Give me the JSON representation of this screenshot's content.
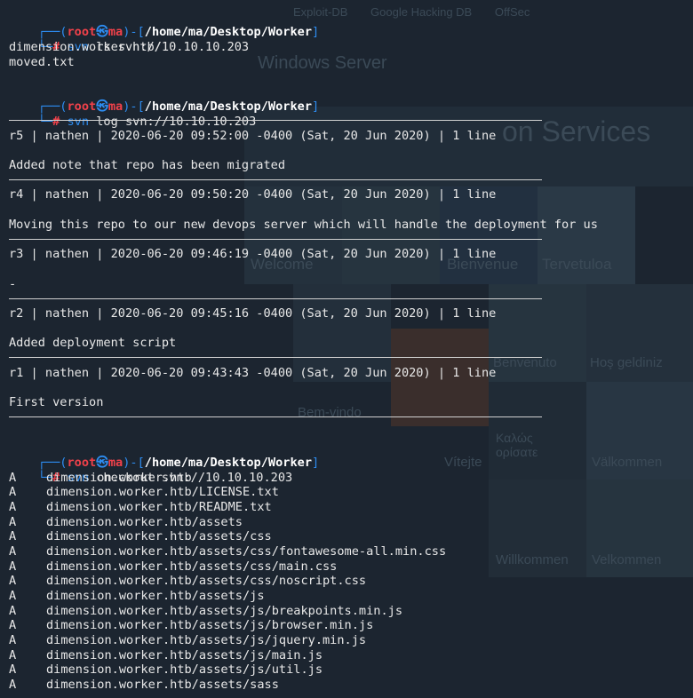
{
  "background": {
    "tabs": [
      "Exploit-DB",
      "Google Hacking DB",
      "OffSec"
    ],
    "windows_server": "Windows Server",
    "services_title": "on Services",
    "welcome_words": [
      "Welcome",
      "Bienvenue",
      "Tervetuloa",
      "Benvenuto",
      "Hoş geldiniz",
      "Bem-vindo",
      "Καλώς ορίσατε",
      "Vítejte",
      "Välkommen",
      "Willkommen",
      "Velkommen"
    ]
  },
  "prompt": {
    "user": "root",
    "host": "ma",
    "skull": "㉿",
    "path": "/home/ma/Desktop/Worker",
    "symbol": "#"
  },
  "blocks": {
    "ls": {
      "command": "svn",
      "args": "ls svn://10.10.10.203",
      "output": [
        "dimension.worker.htb/",
        "moved.txt"
      ]
    },
    "log": {
      "command": "svn",
      "args": "log svn://10.10.10.203",
      "entries": [
        {
          "header": "r5 | nathen | 2020-06-20 09:52:00 -0400 (Sat, 20 Jun 2020) | 1 line",
          "message": "Added note that repo has been migrated"
        },
        {
          "header": "r4 | nathen | 2020-06-20 09:50:20 -0400 (Sat, 20 Jun 2020) | 1 line",
          "message": "Moving this repo to our new devops server which will handle the deployment for us"
        },
        {
          "header": "r3 | nathen | 2020-06-20 09:46:19 -0400 (Sat, 20 Jun 2020) | 1 line",
          "message": "-"
        },
        {
          "header": "r2 | nathen | 2020-06-20 09:45:16 -0400 (Sat, 20 Jun 2020) | 1 line",
          "message": "Added deployment script"
        },
        {
          "header": "r1 | nathen | 2020-06-20 09:43:43 -0400 (Sat, 20 Jun 2020) | 1 line",
          "message": "First version"
        }
      ]
    },
    "checkout": {
      "command": "svn",
      "args": "checkout svn://10.10.10.203",
      "rows": [
        {
          "flag": "A",
          "path": "dimension.worker.htb"
        },
        {
          "flag": "A",
          "path": "dimension.worker.htb/LICENSE.txt"
        },
        {
          "flag": "A",
          "path": "dimension.worker.htb/README.txt"
        },
        {
          "flag": "A",
          "path": "dimension.worker.htb/assets"
        },
        {
          "flag": "A",
          "path": "dimension.worker.htb/assets/css"
        },
        {
          "flag": "A",
          "path": "dimension.worker.htb/assets/css/fontawesome-all.min.css"
        },
        {
          "flag": "A",
          "path": "dimension.worker.htb/assets/css/main.css"
        },
        {
          "flag": "A",
          "path": "dimension.worker.htb/assets/css/noscript.css"
        },
        {
          "flag": "A",
          "path": "dimension.worker.htb/assets/js"
        },
        {
          "flag": "A",
          "path": "dimension.worker.htb/assets/js/breakpoints.min.js"
        },
        {
          "flag": "A",
          "path": "dimension.worker.htb/assets/js/browser.min.js"
        },
        {
          "flag": "A",
          "path": "dimension.worker.htb/assets/js/jquery.min.js"
        },
        {
          "flag": "A",
          "path": "dimension.worker.htb/assets/js/main.js"
        },
        {
          "flag": "A",
          "path": "dimension.worker.htb/assets/js/util.js"
        },
        {
          "flag": "A",
          "path": "dimension.worker.htb/assets/sass"
        }
      ]
    }
  },
  "colors": {
    "terminal_bg": "#1c2530",
    "prompt_blue": "#2d8cf0",
    "prompt_red": "#f0414a",
    "text": "#e8e8e8"
  }
}
